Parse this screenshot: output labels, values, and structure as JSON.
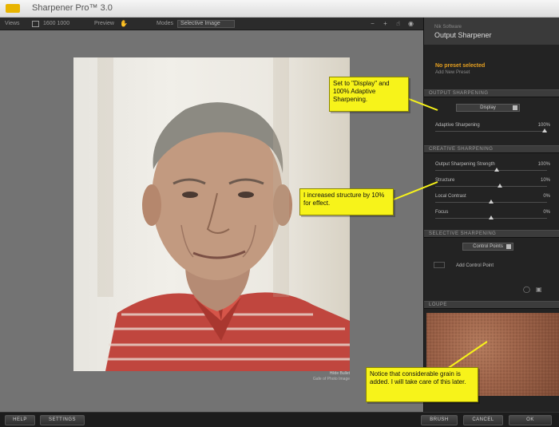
{
  "window": {
    "title": "Sharpener Pro™ 3.0"
  },
  "toolbar": {
    "view_label": "Views",
    "view_value": "1600 1000",
    "compare_label": "Preview",
    "mode_label": "Modes",
    "preview_dropdown": "Selective Image"
  },
  "photo": {
    "caption_line1": "Hilde Bullet",
    "caption_line2": "Gafe of Photo Image"
  },
  "panel": {
    "brand": "Nik Software",
    "name": "Output Sharpener",
    "status": "No preset selected",
    "status_sub": "Add New Preset",
    "sections": {
      "output": "OUTPUT SHARPENING",
      "creative": "CREATIVE SHARPENING",
      "selective": "SELECTIVE SHARPENING",
      "loupe": "LOUPE"
    },
    "output_dropdown": "Display",
    "adaptive": {
      "label": "Adaptive Sharpening",
      "value": "100%",
      "level": 1.0
    },
    "creative_sliders": [
      {
        "label": "Output Sharpening Strength",
        "value": "100%",
        "level": 0.55
      },
      {
        "label": "Structure",
        "value": "10%",
        "level": 0.58
      },
      {
        "label": "Local Contrast",
        "value": "0%",
        "level": 0.5
      },
      {
        "label": "Focus",
        "value": "0%",
        "level": 0.5
      }
    ],
    "selective_dropdown": "Control Points",
    "add_control": "Add Control Point"
  },
  "bottombar": {
    "help": "HELP",
    "settings": "SETTINGS",
    "brush": "BRUSH",
    "cancel": "CANCEL",
    "ok": "OK"
  },
  "callouts": {
    "display": "Set to \"Display\" and 100% Adaptive Sharpening.",
    "structure": "I increased structure by 10% for effect.",
    "grain": "Notice that considerable grain is added. I will take care of this later."
  },
  "colors": {
    "accent": "#e6a020",
    "callout": "#f7f31a",
    "panel_bg": "#232323",
    "canvas_bg": "#737373"
  }
}
